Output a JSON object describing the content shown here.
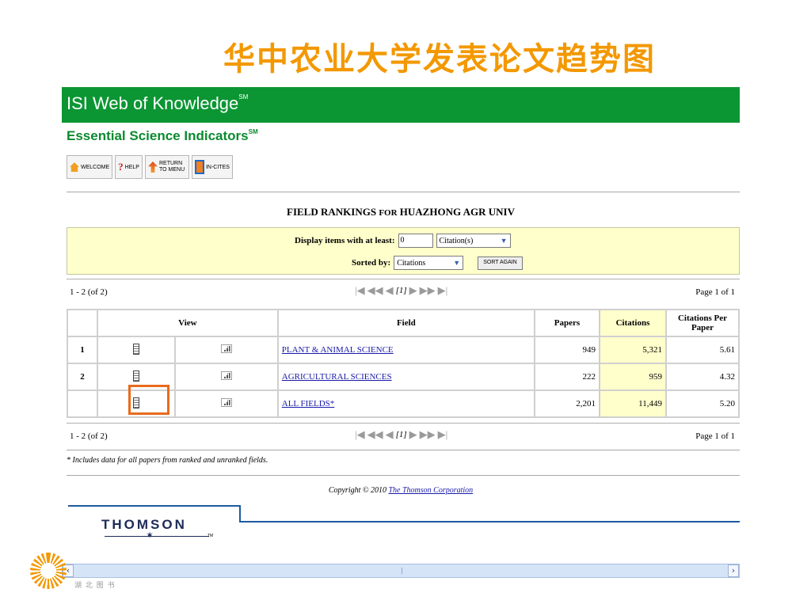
{
  "slide": {
    "title": "华中农业大学发表论文趋势图"
  },
  "brand": {
    "isi": "ISI Web of Knowledge",
    "isi_sup": "SM",
    "esi": "Essential Science Indicators",
    "esi_sup": "SM",
    "header_color": "#0b9633"
  },
  "nav": [
    {
      "label": "WELCOME",
      "icon": "home-icon"
    },
    {
      "label": "HELP",
      "icon": "help-icon"
    },
    {
      "label": "RETURN TO MENU",
      "icon": "return-icon"
    },
    {
      "label": "IN-CITES",
      "icon": "incites-icon"
    }
  ],
  "report": {
    "title_main": "FIELD RANKINGS ",
    "title_small": "FOR",
    "title_end": " HUAZHONG AGR UNIV"
  },
  "filters": {
    "display_label": "Display items with at least:",
    "display_value": "0",
    "unit": "Citation(s)",
    "sort_label": "Sorted by:",
    "sort_value": "Citations",
    "sort_button": "SORT AGAIN"
  },
  "pager": {
    "count": "1 - 2 (of 2)",
    "current": "[1]",
    "page_of": "Page 1 of 1"
  },
  "table": {
    "headers": {
      "view": "View",
      "field": "Field",
      "papers": "Papers",
      "citations": "Citations",
      "cpp": "Citations Per Paper"
    },
    "rows": [
      {
        "rank": "1",
        "field": "PLANT & ANIMAL SCIENCE",
        "papers": "949",
        "citations": "5,321",
        "cpp": "5.61"
      },
      {
        "rank": "2",
        "field": "AGRICULTURAL SCIENCES",
        "papers": "222",
        "citations": "959",
        "cpp": "4.32"
      },
      {
        "rank": "",
        "field": "ALL FIELDS*",
        "papers": "2,201",
        "citations": "11,449",
        "cpp": "5.20"
      }
    ]
  },
  "footnote": "* Includes data for all papers from ranked and unranked fields.",
  "copyright": {
    "text": "Copyright © 2010 ",
    "link": "The Thomson Corporation"
  },
  "thomson": {
    "logo": "THOMSON",
    "tm": "TM"
  },
  "bottom_logo_text": "湖 北 图 书"
}
